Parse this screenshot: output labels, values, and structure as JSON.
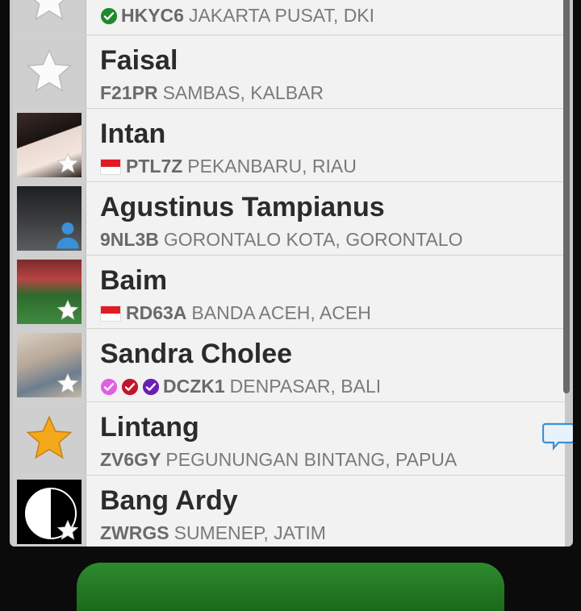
{
  "contacts": [
    {
      "name": "",
      "code": "HKYC6",
      "location": "JAKARTA PUSAT, DKI",
      "badges": [
        "green-check"
      ],
      "flag": false,
      "avatar": "star-gray"
    },
    {
      "name": "Faisal",
      "code": "F21PR",
      "location": "SAMBAS, KALBAR",
      "badges": [],
      "flag": false,
      "avatar": "star-gray"
    },
    {
      "name": "Intan",
      "code": "PTL7Z",
      "location": "PEKANBARU, RIAU",
      "badges": [],
      "flag": true,
      "avatar": "photo"
    },
    {
      "name": "Agustinus Tampianus",
      "code": "9NL3B",
      "location": "GORONTALO KOTA, GORONTALO",
      "badges": [],
      "flag": false,
      "avatar": "photo"
    },
    {
      "name": "Baim",
      "code": "RD63A",
      "location": "BANDA ACEH, ACEH",
      "badges": [],
      "flag": true,
      "avatar": "photo"
    },
    {
      "name": "Sandra Cholee",
      "code": "DCZK1",
      "location": "DENPASAR, BALI",
      "badges": [
        "pink-check",
        "red-check",
        "purple-check"
      ],
      "flag": false,
      "avatar": "photo"
    },
    {
      "name": "Lintang",
      "code": "ZV6GY",
      "location": "PEGUNUNGAN BINTANG, PAPUA",
      "badges": [],
      "flag": false,
      "avatar": "star-gold"
    },
    {
      "name": "Bang Ardy",
      "code": "ZWRGS",
      "location": "SUMENEP, JATIM",
      "badges": [],
      "flag": false,
      "avatar": "photo"
    }
  ],
  "colors": {
    "green_check": "#1e8a2e",
    "pink_check": "#e060e0",
    "red_check": "#c0182a",
    "purple_check": "#6a1fb0",
    "gold_star": "#f4a81c",
    "flag_red": "#e01b22",
    "chat_icon": "#3a8fd6"
  },
  "icons": {
    "favorite": "star-icon",
    "message": "chat-bubble-icon",
    "verified": "check-circle-icon",
    "country": "indonesia-flag-icon"
  }
}
